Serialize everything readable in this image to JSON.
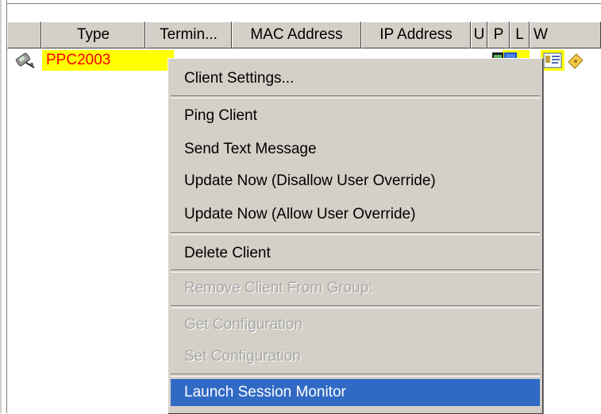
{
  "table": {
    "columns": [
      "Type",
      "Termin...",
      "MAC Address",
      "IP Address",
      "U",
      "P",
      "L",
      "W"
    ],
    "row": {
      "type": "PPC2003",
      "highlight_color": "#ffff00",
      "text_color": "#ff0000"
    }
  },
  "context_menu": {
    "items": [
      {
        "label": "Client Settings...",
        "enabled": true
      },
      {
        "label": "Ping Client",
        "enabled": true
      },
      {
        "label": "Send Text Message",
        "enabled": true
      },
      {
        "label": "Update Now (Disallow User Override)",
        "enabled": true
      },
      {
        "label": "Update Now (Allow User Override)",
        "enabled": true
      },
      {
        "label": "Delete Client",
        "enabled": true
      },
      {
        "label": "Remove Client From Group:",
        "enabled": false
      },
      {
        "label": "Get Configuration",
        "enabled": false
      },
      {
        "label": "Set Configuration",
        "enabled": false
      },
      {
        "label": "Launch Session Monitor",
        "enabled": true,
        "selected": true
      }
    ],
    "selection_color": "#316ac5"
  }
}
